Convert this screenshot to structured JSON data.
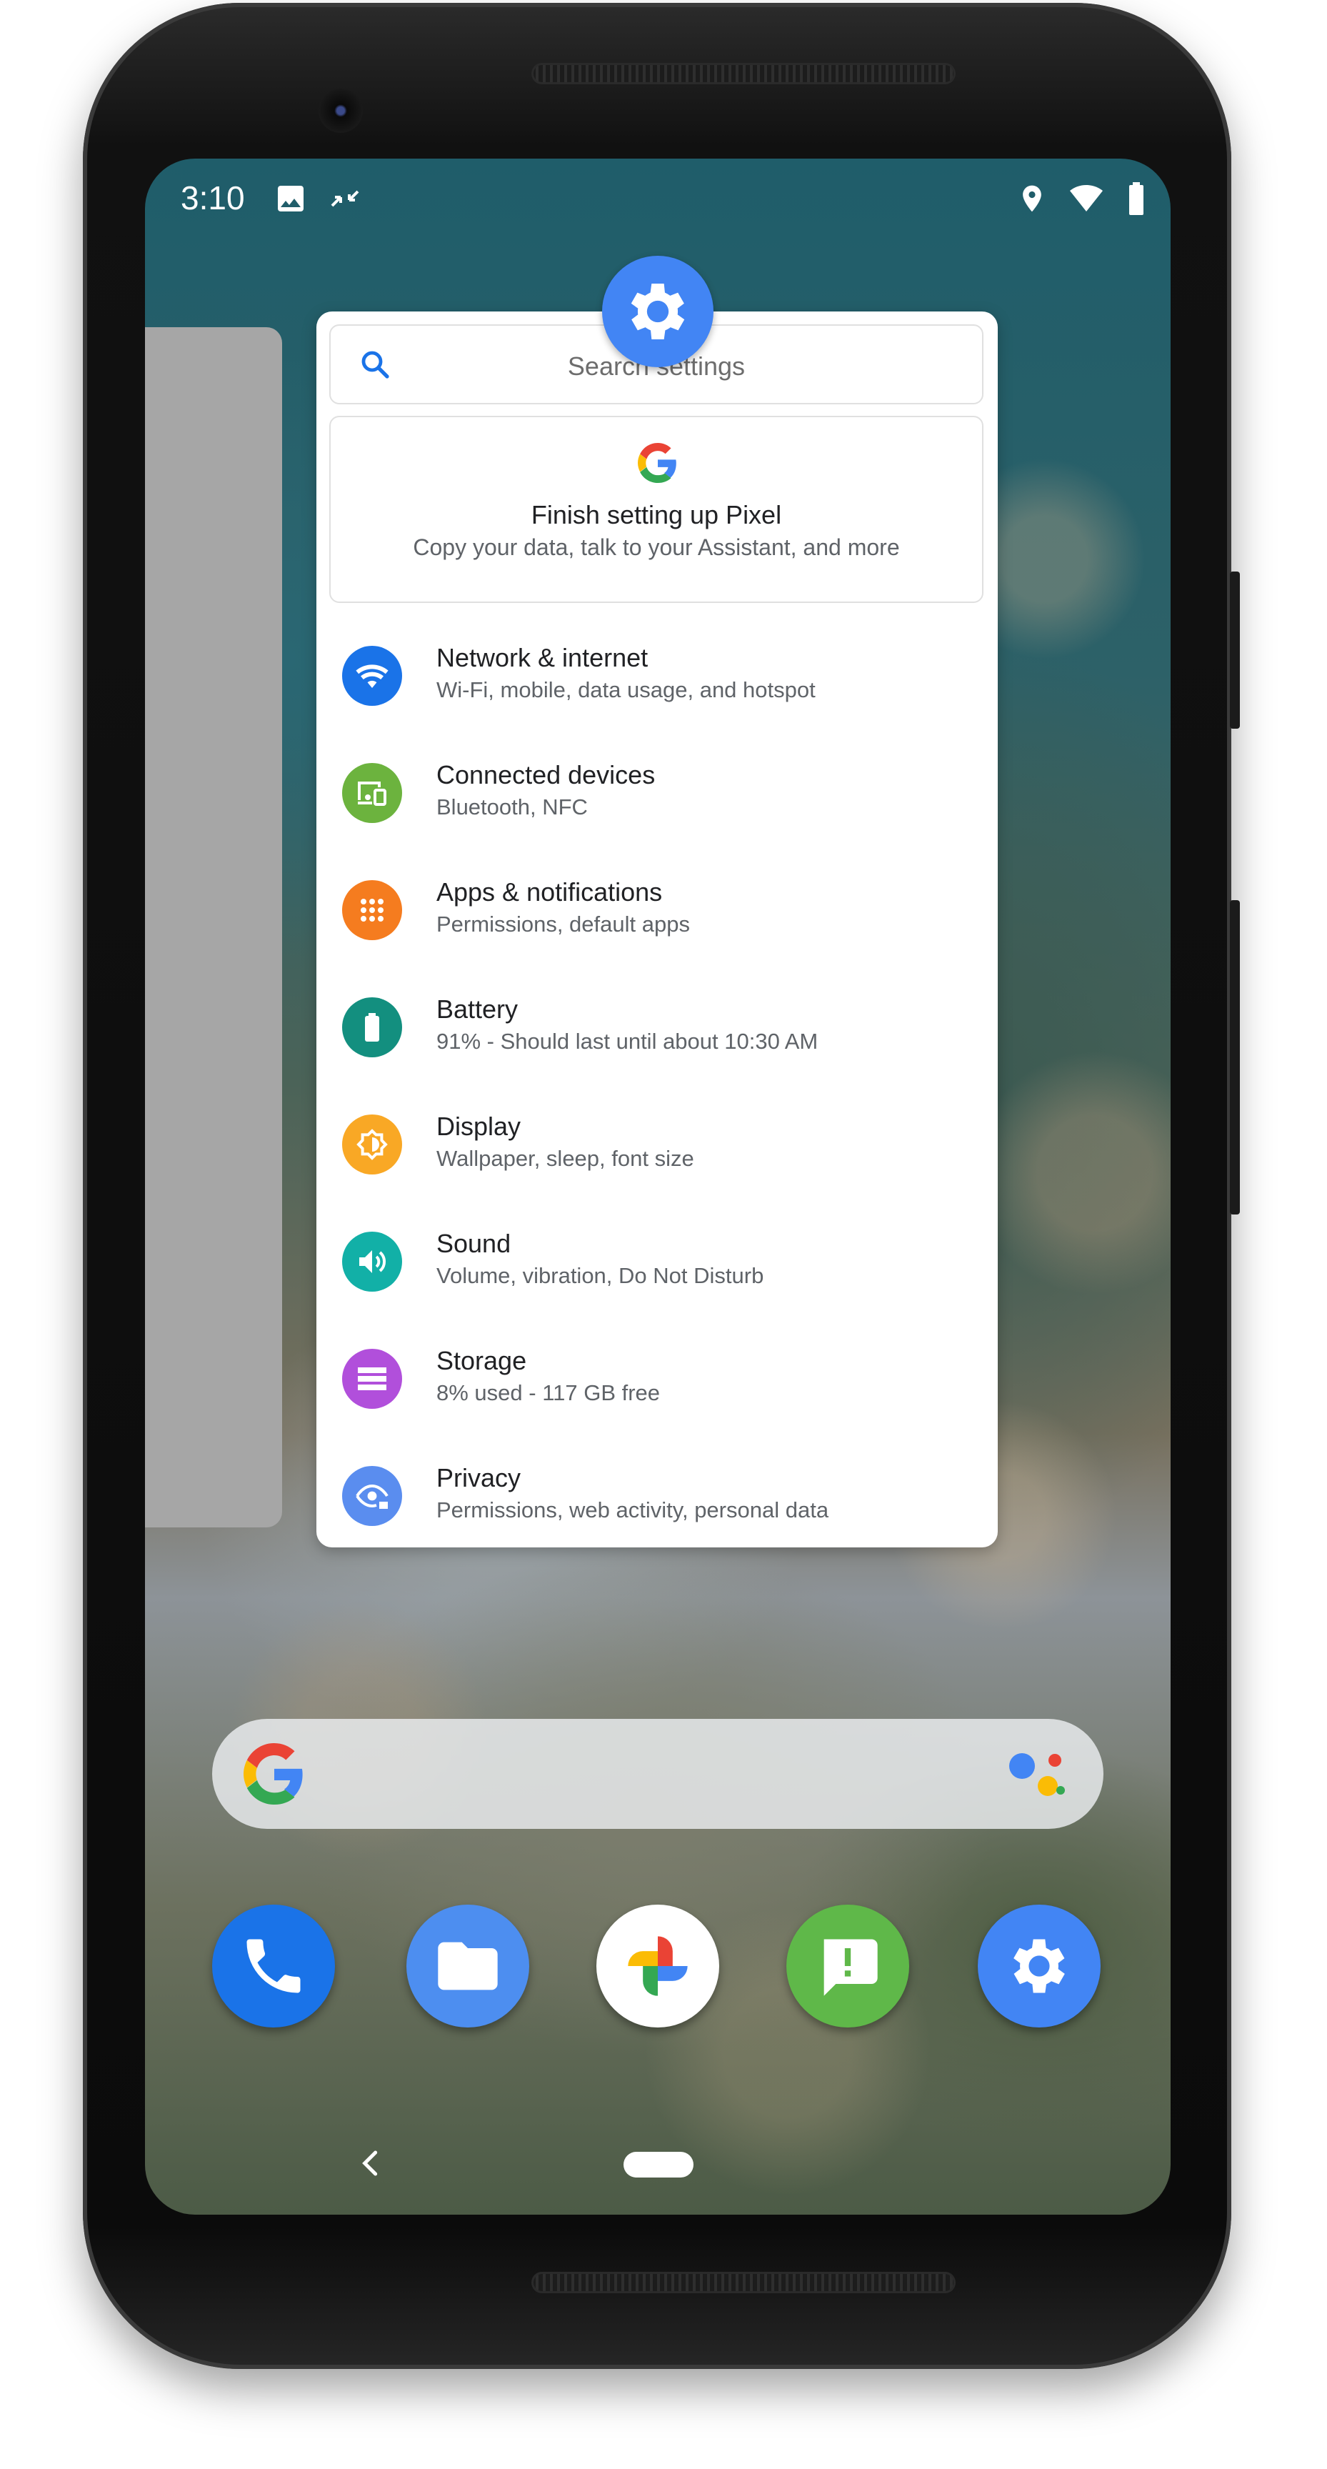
{
  "status_bar": {
    "time": "3:10",
    "icons": [
      "image-icon",
      "data-saver-icon",
      "location-icon",
      "wifi-icon",
      "battery-icon"
    ]
  },
  "settings": {
    "search_placeholder": "Search settings",
    "suggestion": {
      "title": "Finish setting up Pixel",
      "subtitle": "Copy your data, talk to your Assistant, and more"
    },
    "items": [
      {
        "title": "Network & internet",
        "subtitle": "Wi-Fi, mobile, data usage, and hotspot",
        "icon": "wifi-icon",
        "color": "#1a73e8"
      },
      {
        "title": "Connected devices",
        "subtitle": "Bluetooth, NFC",
        "icon": "devices-icon",
        "color": "#6cb33e"
      },
      {
        "title": "Apps & notifications",
        "subtitle": "Permissions, default apps",
        "icon": "apps-icon",
        "color": "#f57c1f"
      },
      {
        "title": "Battery",
        "subtitle": "91% - Should last until about 10:30 AM",
        "icon": "battery-icon",
        "color": "#138f7f"
      },
      {
        "title": "Display",
        "subtitle": "Wallpaper, sleep, font size",
        "icon": "brightness-icon",
        "color": "#f9a825"
      },
      {
        "title": "Sound",
        "subtitle": "Volume, vibration, Do Not Disturb",
        "icon": "volume-icon",
        "color": "#12b0a7"
      },
      {
        "title": "Storage",
        "subtitle": "8% used - 117 GB free",
        "icon": "storage-icon",
        "color": "#b14fdb"
      },
      {
        "title": "Privacy",
        "subtitle": "Permissions, web activity, personal data",
        "icon": "privacy-eye-icon",
        "color": "#5a8def"
      }
    ]
  },
  "dock": [
    "phone-app-icon",
    "files-app-icon",
    "photos-app-icon",
    "messages-app-icon",
    "settings-app-icon"
  ],
  "colors": {
    "accent": "#4285f4",
    "recent_card": "#a6a6a6"
  }
}
